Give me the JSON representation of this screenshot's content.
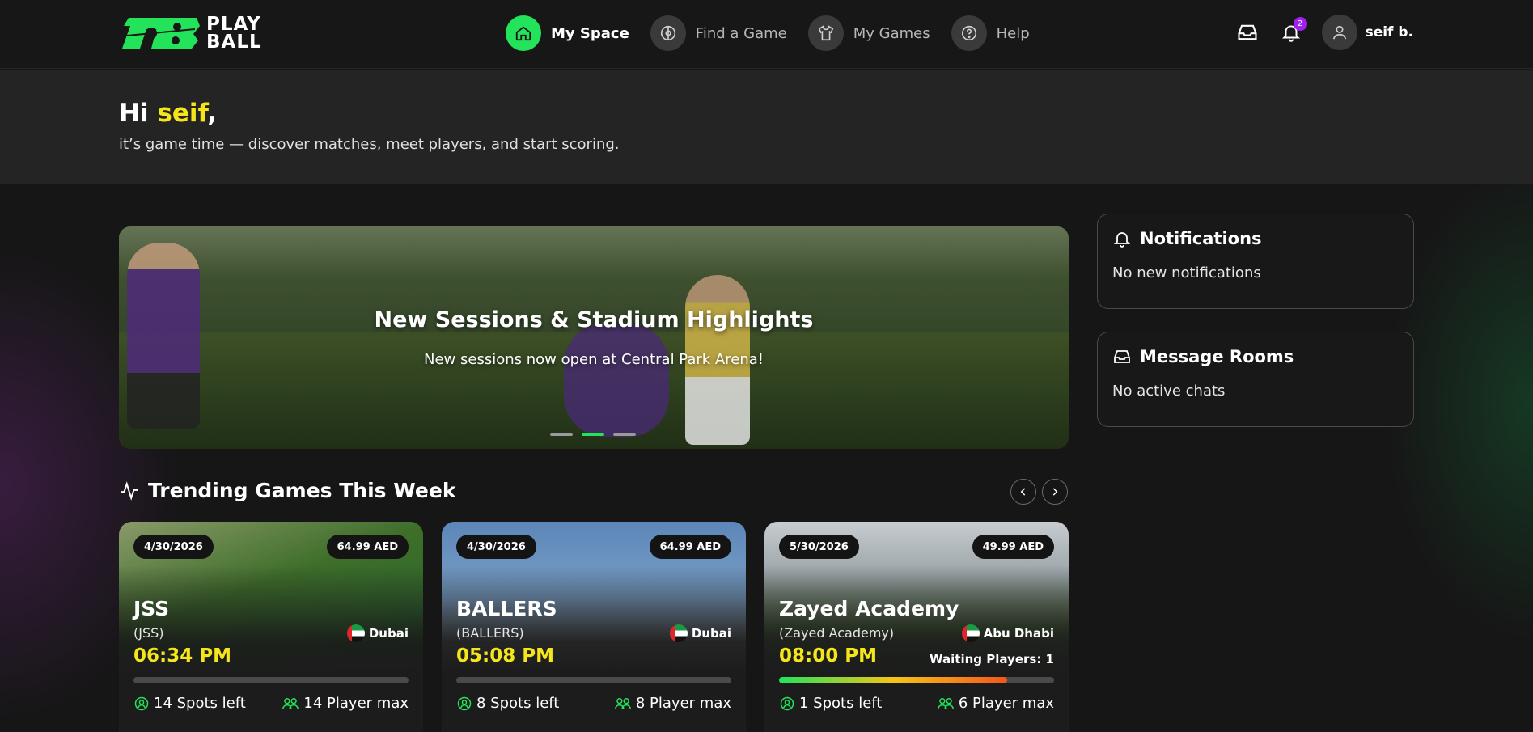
{
  "app": {
    "logo_text_1": "PLAY",
    "logo_text_2": "BALL",
    "accent": "#22e35a",
    "highlight": "#f5e51b"
  },
  "nav": {
    "items": [
      {
        "label": "My Space",
        "icon": "home-icon",
        "active": true
      },
      {
        "label": "Find a Game",
        "icon": "ball-icon",
        "active": false
      },
      {
        "label": "My Games",
        "icon": "shirt-icon",
        "active": false
      },
      {
        "label": "Help",
        "icon": "help-icon",
        "active": false
      }
    ]
  },
  "topright": {
    "notification_count": "2",
    "username": "seif b."
  },
  "greeting": {
    "hi": "Hi ",
    "name": "seif",
    "comma": ",",
    "subtitle": "it’s game time — discover matches, meet players, and start scoring."
  },
  "hero": {
    "title": "New Sessions & Stadium Highlights",
    "subtitle": "New sessions now open at Central Park Arena!",
    "slides": 3,
    "active_slide": 2
  },
  "trending": {
    "title": "Trending Games This Week"
  },
  "games": [
    {
      "date": "4/30/2026",
      "price": "64.99 AED",
      "title": "JSS",
      "sub": "(JSS)",
      "city": "Dubai",
      "time": "06:34 PM",
      "waiting": "",
      "fill": 0,
      "spots": "14 Spots left",
      "max": "14 Player max"
    },
    {
      "date": "4/30/2026",
      "price": "64.99 AED",
      "title": "BALLERS",
      "sub": "(BALLERS)",
      "city": "Dubai",
      "time": "05:08 PM",
      "waiting": "",
      "fill": 0,
      "spots": "8 Spots left",
      "max": "8 Player max"
    },
    {
      "date": "5/30/2026",
      "price": "49.99 AED",
      "title": "Zayed Academy",
      "sub": "(Zayed Academy)",
      "city": "Abu Dhabi",
      "time": "08:00 PM",
      "waiting": "Waiting Players: 1",
      "fill": 0.83,
      "spots": "1 Spots left",
      "max": "6 Player max"
    }
  ],
  "notifications": {
    "title": "Notifications",
    "empty": "No new notifications"
  },
  "messages": {
    "title": "Message Rooms",
    "empty": "No active chats"
  }
}
